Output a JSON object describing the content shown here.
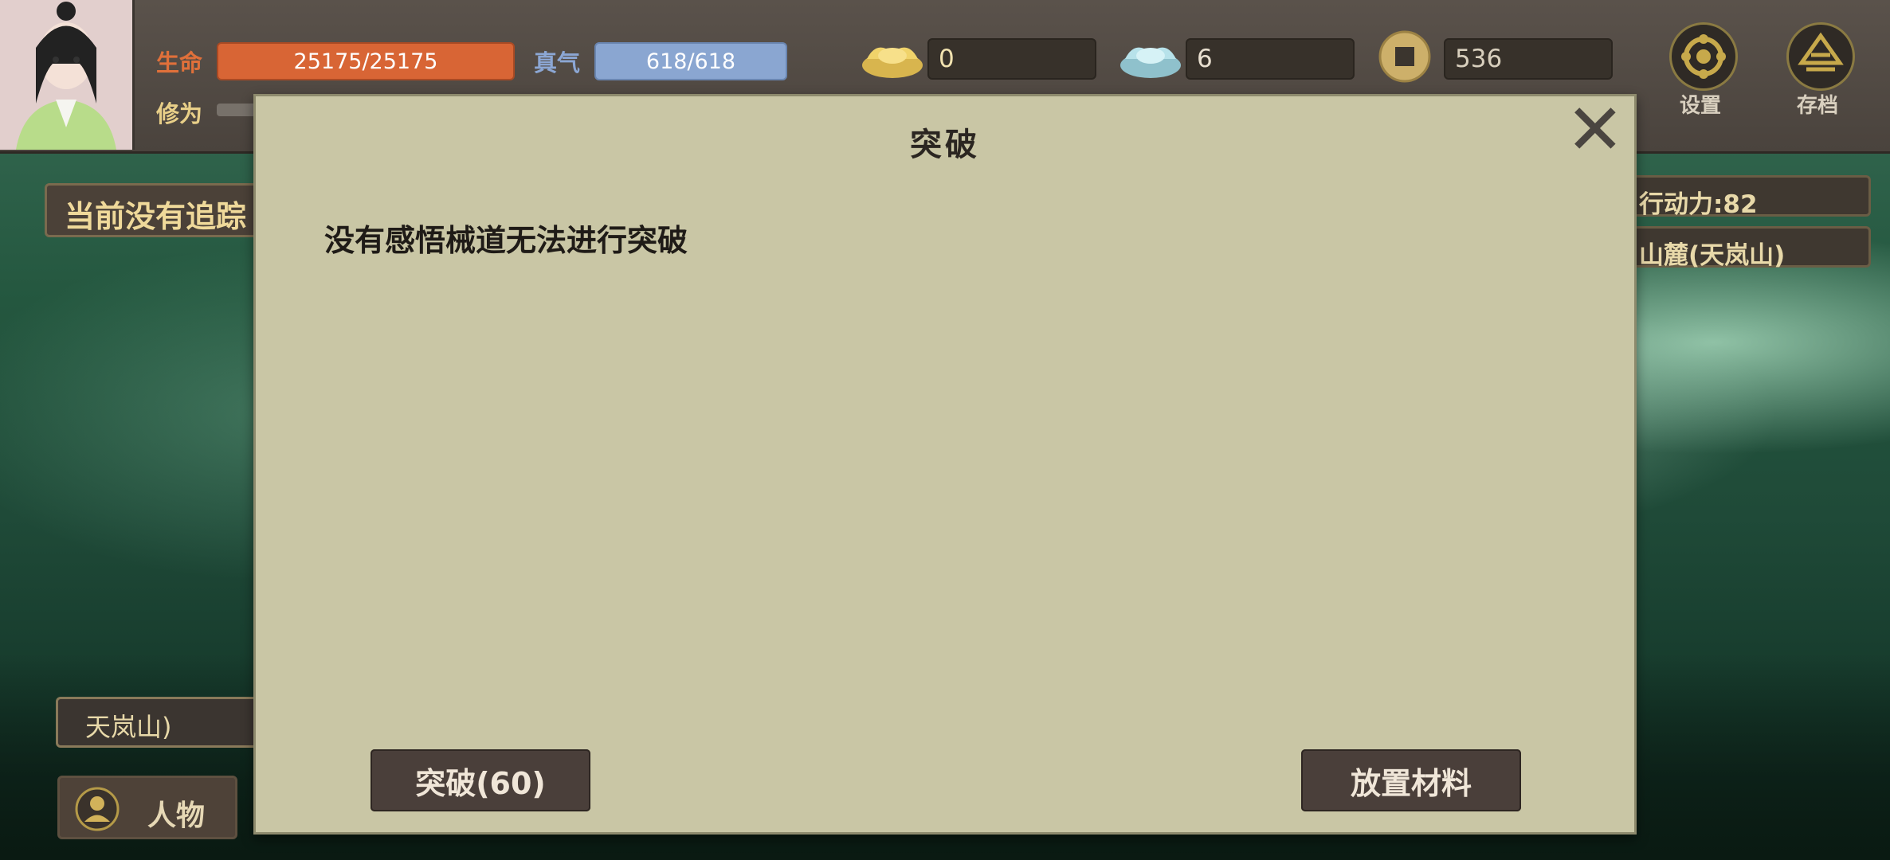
{
  "stats": {
    "hp_label": "生命",
    "hp_value": "25175/25175",
    "hp_fill": 1.0,
    "qi_label": "真气",
    "qi_value": "618/618",
    "qi_fill": 1.0,
    "cultivation_label": "修为"
  },
  "currencies": [
    {
      "icon": "gold-ingot-icon",
      "value": "0"
    },
    {
      "icon": "silver-ingot-icon",
      "value": "6"
    },
    {
      "icon": "copper-coin-icon",
      "value": "536"
    }
  ],
  "top_buttons": {
    "settings_label": "设置",
    "save_label": "存档"
  },
  "left_panel": {
    "tracking_text": "当前没有追踪",
    "location_text": "天岚山)",
    "character_label": "人物"
  },
  "right_panel": {
    "action_points": "行动力:82",
    "location": "山麓(天岚山)"
  },
  "dialog": {
    "title": "突破",
    "message": "没有感悟械道无法进行突破",
    "breakthrough_button": "突破(60)",
    "place_material_button": "放置材料"
  },
  "colors": {
    "hp_bar": "#d86535",
    "qi_bar": "#8aa6d1",
    "dialog_bg": "#c9c6a5",
    "button_bg": "#4a3f3a"
  }
}
